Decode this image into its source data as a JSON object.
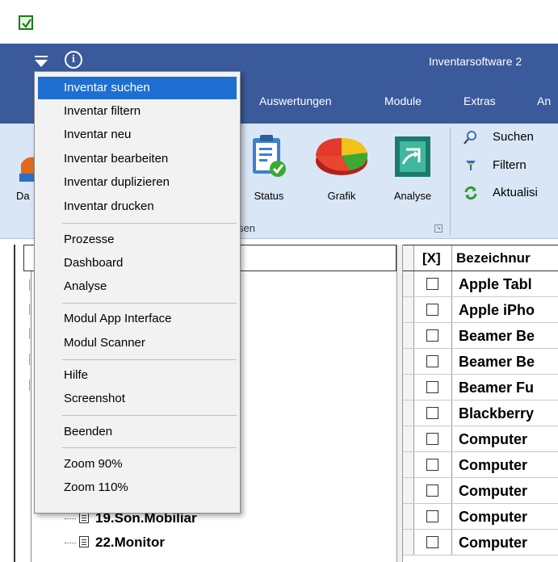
{
  "app": {
    "title": "Inventarsoftware 2",
    "info_glyph": "i",
    "icon": "app-check-icon"
  },
  "menu_tabs": [
    "Auswertungen",
    "Module",
    "Extras",
    "An"
  ],
  "ribbon": {
    "partial_label": "Da",
    "buttons": [
      {
        "label": "Status",
        "icon": "clipboard-check-icon"
      },
      {
        "label": "Grafik",
        "icon": "pie-chart-icon"
      },
      {
        "label": "Analyse",
        "icon": "analysis-icon"
      }
    ],
    "group_label": "sen",
    "side_commands": [
      {
        "label": "Suchen",
        "icon": "magnifier-icon"
      },
      {
        "label": "Filtern",
        "icon": "funnel-icon"
      },
      {
        "label": "Aktualisi",
        "icon": "refresh-icon"
      }
    ]
  },
  "dropdown": {
    "items": [
      "Inventar suchen",
      "Inventar filtern",
      "Inventar neu",
      "Inventar bearbeiten",
      "Inventar duplizieren",
      "Inventar drucken",
      "Prozesse",
      "Dashboard",
      "Analyse",
      "Modul App Interface",
      "Modul Scanner",
      "Hilfe",
      "Screenshot",
      "Beenden",
      "Zoom 90%",
      "Zoom 110%"
    ]
  },
  "tree": {
    "nodes": [
      "19.Son.Mobiliar",
      "22.Monitor"
    ]
  },
  "grid": {
    "header_check": "[X]",
    "header_title": "Bezeichnur",
    "rows": [
      "Apple Tabl",
      "Apple iPho",
      "Beamer Be",
      "Beamer Be",
      "Beamer Fu",
      "Blackberry",
      "Computer",
      "Computer",
      "Computer",
      "Computer",
      "Computer"
    ]
  },
  "colors": {
    "ribbon_header": "#3b5a9c",
    "ribbon_body": "#d9e6f5",
    "menu_highlight": "#1e6fd1"
  }
}
